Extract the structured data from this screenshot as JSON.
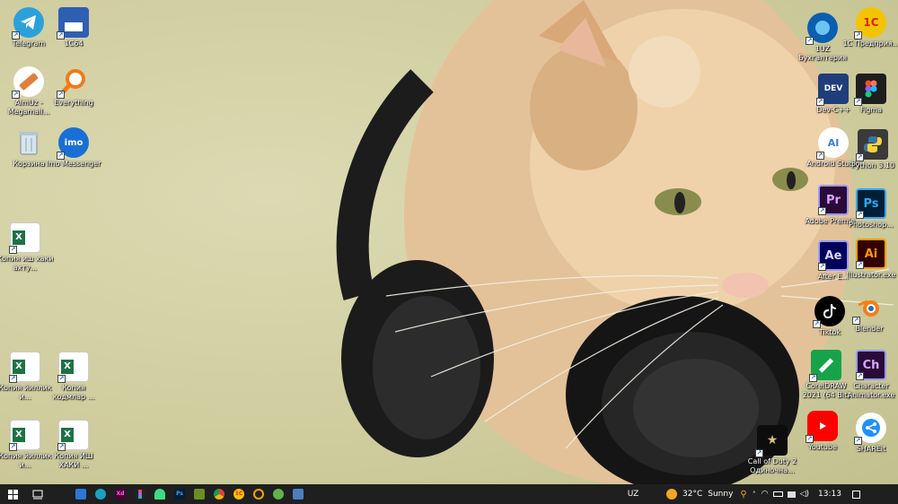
{
  "desktop": {
    "left_icons": [
      {
        "label": "Telegram"
      },
      {
        "label": "1C64"
      },
      {
        "label": "AimUz - Megamail..."
      },
      {
        "label": "Everything"
      },
      {
        "label": "Корзина"
      },
      {
        "label": "imo Messenger"
      },
      {
        "label": "Копия иш хаки ахту..."
      },
      {
        "label": "Копия йиллик и..."
      },
      {
        "label": "Копия кодмлар ..."
      },
      {
        "label": "Копия йиллик и..."
      },
      {
        "label": "Копия ИШ ХАКИ ..."
      }
    ],
    "right_icons": [
      {
        "label": "1UZ Бухгалтерия"
      },
      {
        "label": "1С Предприя..."
      },
      {
        "label": "Dev-C++"
      },
      {
        "label": "Figma"
      },
      {
        "label": "Android Studio"
      },
      {
        "label": "Python 3.10"
      },
      {
        "label": "Adobe Premie..."
      },
      {
        "label": "Photoshop..."
      },
      {
        "label": "After E..."
      },
      {
        "label": "Illustrator.exe"
      },
      {
        "label": "Tiktok"
      },
      {
        "label": "Blender"
      },
      {
        "label": "CorelDRAW 2021 (64 Bit)"
      },
      {
        "label": "Character Animator.exe"
      },
      {
        "label": "Call of Duty 2 Одиночна..."
      },
      {
        "label": "Youtube"
      },
      {
        "label": "SHAREit"
      }
    ]
  },
  "taskbar": {
    "start_icon": "windows-start-icon",
    "task_view_icon": "task-view-icon",
    "pinned_apps": [
      "explorer",
      "edge",
      "adobe-xd",
      "figma",
      "android-studio",
      "photoshop",
      "minecraft",
      "chrome",
      "1c",
      "aimp",
      "game",
      "anydesk"
    ],
    "language": "UZ",
    "weather_temp": "32°C",
    "weather_text": "Sunny",
    "time": "13:13"
  }
}
